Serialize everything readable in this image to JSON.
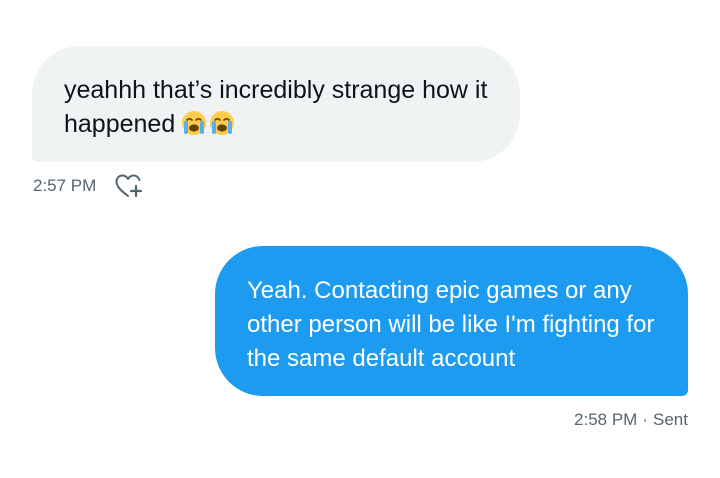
{
  "messages": {
    "incoming": {
      "text": "yeahhh that’s incredibly strange how it happened",
      "emojis": [
        "loudly-crying-face-emoji",
        "loudly-crying-face-emoji"
      ],
      "time": "2:57 PM",
      "reaction_icon": "heart-plus-icon"
    },
    "outgoing": {
      "text": "Yeah. Contacting epic games or any other person will be like I'm fighting for the same default account",
      "time": "2:58 PM",
      "separator": "·",
      "status": "Sent"
    }
  },
  "colors": {
    "incoming_bubble": "#eff3f4",
    "outgoing_bubble": "#1d9bf0",
    "meta_text": "#536471"
  }
}
